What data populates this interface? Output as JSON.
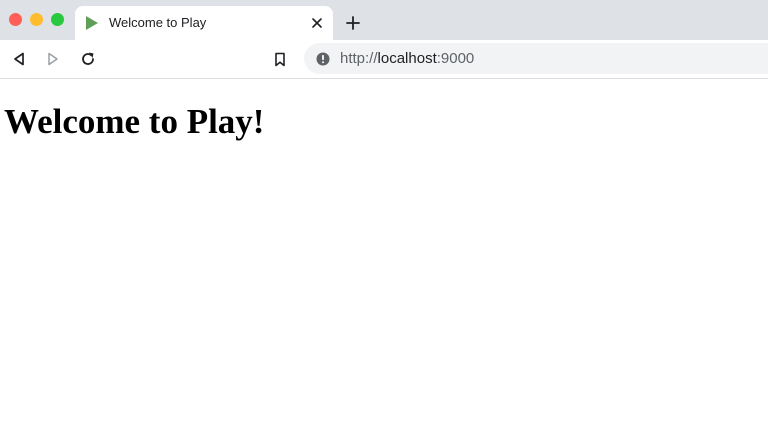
{
  "window": {
    "controls": {
      "close_color": "#ff5f57",
      "minimize_color": "#febc2e",
      "maximize_color": "#28c840"
    }
  },
  "tab": {
    "title": "Welcome to Play",
    "favicon": "play-triangle-icon",
    "favicon_color": "#5f9f57"
  },
  "toolbar": {
    "back_icon": "back-icon",
    "forward_icon": "forward-icon",
    "reload_icon": "reload-icon",
    "bookmark_icon": "bookmark-icon"
  },
  "address_bar": {
    "security_icon": "info-icon",
    "scheme": "http://",
    "host": "localhost",
    "port": ":9000"
  },
  "page": {
    "heading": "Welcome to Play!"
  }
}
